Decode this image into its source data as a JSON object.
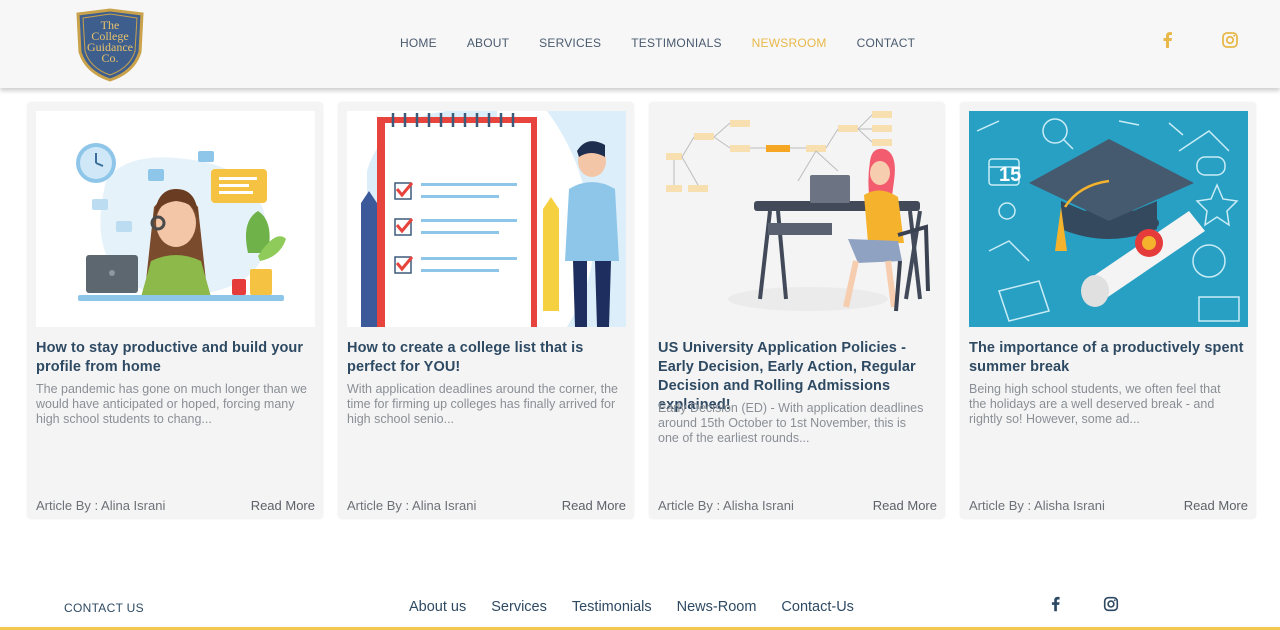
{
  "brand": {
    "logo_text_1": "The",
    "logo_text_2": "College",
    "logo_text_3": "Guidance",
    "logo_text_4": "Co."
  },
  "nav": {
    "items": [
      {
        "label": "HOME"
      },
      {
        "label": "ABOUT"
      },
      {
        "label": "SERVICES"
      },
      {
        "label": "TESTIMONIALS"
      },
      {
        "label": "NEWSROOM"
      },
      {
        "label": "CONTACT"
      }
    ],
    "active": "NEWSROOM"
  },
  "social": {
    "facebook_icon": "facebook-icon",
    "instagram_icon": "instagram-icon"
  },
  "colors": {
    "accent": "#e8b84a",
    "primary_text": "#2e4a63",
    "card_bg": "#f4f4f4",
    "footer_bar": "#f3c94d"
  },
  "articles": [
    {
      "title": "How to stay productive and build your profile from home",
      "excerpt": "The pandemic has gone on much longer than we would have anticipated or hoped, forcing many high school students to chang...",
      "author": "Article By : Alina Israni",
      "read_more": "Read More",
      "image_icon": "woman-laptop-headset-illustration"
    },
    {
      "title": "How to create a college list that is perfect for YOU!",
      "excerpt": "With application deadlines around the corner, the time for firming up colleges has finally arrived for high school senio...",
      "author": "Article By : Alina Israni",
      "read_more": "Read More",
      "image_icon": "checklist-notepad-illustration"
    },
    {
      "title": "US University Application Policies - Early Decision, Early Action, Regular Decision and Rolling Admissions explained!",
      "excerpt": "Early Decision (ED) - With application deadlines around 15th October to 1st November, this is one of the earliest rounds...",
      "author": "Article By : Alisha Israni",
      "read_more": "Read More",
      "image_icon": "woman-desk-flowchart-illustration"
    },
    {
      "title": "The importance of a productively spent summer break",
      "excerpt": "Being high school students, we often feel that the holidays are a well deserved break - and rightly so! However, some ad...",
      "author": "Article By : Alisha Israni",
      "read_more": "Read More",
      "image_icon": "graduation-cap-diploma-illustration"
    }
  ],
  "footer": {
    "contact_label": "CONTACT US",
    "links": [
      {
        "label": "About us"
      },
      {
        "label": "Services"
      },
      {
        "label": "Testimonials"
      },
      {
        "label": "News-Room"
      },
      {
        "label": "Contact-Us"
      }
    ]
  }
}
